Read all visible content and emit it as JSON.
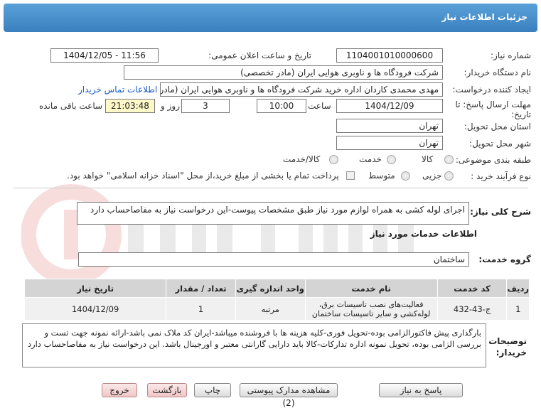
{
  "header": {
    "title": "جزئیات اطلاعات نیاز"
  },
  "fields": {
    "need_number_label": "شماره نیاز:",
    "need_number": "1104001010000600",
    "announce_label": "تاریخ و ساعت اعلان عمومی:",
    "announce_value": "1404/12/05 - 11:56",
    "buyer_label": "نام دستگاه خریدار:",
    "buyer_value": "شرکت فرودگاه ها و ناوبری هوایی ایران (مادر تخصصی)",
    "creator_label": "ایجاد کننده درخواست:",
    "creator_value": "مهدی محمدی کاردان اداره خرید شرکت فرودگاه ها و ناوبری هوایی ایران (مادر تخ",
    "contact_link": "اطلاعات تماس خریدار",
    "deadline_label_1": "مهلت ارسال پاسخ: تا",
    "deadline_label_2": "تاریخ:",
    "deadline_date": "1404/12/09",
    "time_label": "ساعت",
    "deadline_time": "10:00",
    "days_value": "3",
    "days_label": "روز و",
    "remaining_time": "21:03:48",
    "remaining_label": "ساعت باقی مانده",
    "province_label": "استان محل تحویل:",
    "province_value": "تهران",
    "city_label": "شهر محل تحویل:",
    "city_value": "تهران",
    "category_label": "طبقه بندی موضوعی:",
    "category_options": [
      "کالا",
      "خدمت",
      "کالا/خدمت"
    ],
    "process_label": "نوع فرآیند خرید :",
    "process_options": [
      "جزیی",
      "متوسط"
    ],
    "payment_note": "پرداخت تمام یا بخشی از مبلغ خرید،از محل \"اسناد خزانه اسلامی\" خواهد بود."
  },
  "summary": {
    "label": "شرح کلی نیاز:",
    "value": "اجرای لوله کشی به همراه لوازم مورد نیاز طبق مشخصات پیوست-این درخواست نیاز به مفاصاحساب دارد"
  },
  "services": {
    "section_title": "اطلاعات خدمات مورد نیاز",
    "group_label": "گروه خدمت:",
    "group_value": "ساختمان",
    "columns": [
      "ردیف",
      "کد خدمت",
      "نام خدمت",
      "واحد اندازه گیری",
      "تعداد / مقدار",
      "تاریخ نیاز"
    ],
    "rows": [
      [
        "1",
        "ج-43-432",
        "فعالیت‌های نصب تاسیسات برق، لوله‌کشی و سایر تاسیسات ساختمان",
        "مرتبه",
        "1",
        "1404/12/09"
      ]
    ]
  },
  "buyer_notes": {
    "label_1": "توضیحات",
    "label_2": "خریدار:",
    "text": "بارگذاری پیش فاکتورالزامی بوده-تحویل فوری-کلیه هزینه ها با فروشنده میباشد-ایران کد ملاک نمی باشد-ارائه نمونه جهت تست و بررسی الزامی بوده، تحویل نمونه اداره تدارکات-کالا باید دارایی گارانتی معتبر و اورجینال باشد. این درخواست نیاز به مفاصاحساب دارد"
  },
  "buttons": {
    "reply": "پاسخ به نیاز",
    "attachments": "مشاهده مدارک پیوستی (2)",
    "print": "چاپ",
    "back": "بازگشت",
    "exit": "خروج"
  },
  "colors": {
    "header": "#3a80bf",
    "link": "#1a58c8",
    "highlight": "#fff8c8"
  }
}
